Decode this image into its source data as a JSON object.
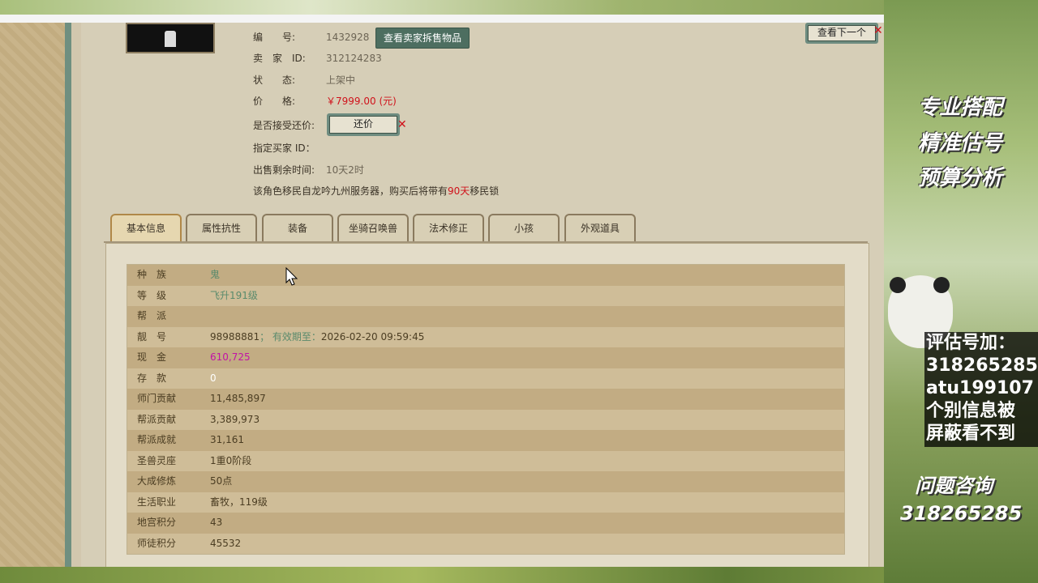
{
  "listing": {
    "id_label": "编　　号:",
    "id_value": "1432928",
    "view_seller_button": "查看卖家拆售物品",
    "seller_label": "卖　家　ID:",
    "seller_value": "312124283",
    "status_label": "状　　态:",
    "status_value": "上架中",
    "price_label": "价　　格:",
    "price_value": "￥7999.00 (元)",
    "counter_offer_label": "是否接受还价:",
    "counter_offer_button": "还价",
    "buyer_label": "指定买家 ID：",
    "remaining_label": "出售剩余时间:",
    "remaining_value": "10天2时",
    "migrate_prefix": "该角色移民自龙吟九州服务器，购买后将带有",
    "migrate_days": "90天",
    "migrate_suffix": "移民锁",
    "next_button": "查看下一个"
  },
  "tabs": [
    "基本信息",
    "属性抗性",
    "装备",
    "坐骑召唤兽",
    "法术修正",
    "小孩",
    "外观道具"
  ],
  "info_rows": [
    {
      "k": "种　族",
      "v": "鬼"
    },
    {
      "k": "等　级",
      "v": "飞升191级"
    },
    {
      "k": "帮　派",
      "v": ""
    },
    {
      "k": "靓　号",
      "v": "98988881",
      "extra": "；  有效期至：",
      "date": "2026-02-20 09:59:45"
    },
    {
      "k": "现　金",
      "v": "610,725"
    },
    {
      "k": "存　款",
      "v": "0"
    },
    {
      "k": "师门贡献",
      "v": "11,485,897"
    },
    {
      "k": "帮派贡献",
      "v": "3,389,973"
    },
    {
      "k": "帮派成就",
      "v": "31,161"
    },
    {
      "k": "圣兽灵座",
      "v": "1重0阶段"
    },
    {
      "k": "大成修炼",
      "v": "50点"
    },
    {
      "k": "生活职业",
      "v": "畜牧，119级"
    },
    {
      "k": "地宫积分",
      "v": "43"
    },
    {
      "k": "师徒积分",
      "v": "45532"
    }
  ],
  "side": {
    "slogans": [
      "专业搭配",
      "精准估号",
      "预算分析"
    ],
    "contact": [
      "评估号加：",
      "318265285",
      "atu199107",
      "个别信息被",
      "屏蔽看不到"
    ],
    "ask_title": "问题咨询",
    "ask_number": "318265285"
  }
}
